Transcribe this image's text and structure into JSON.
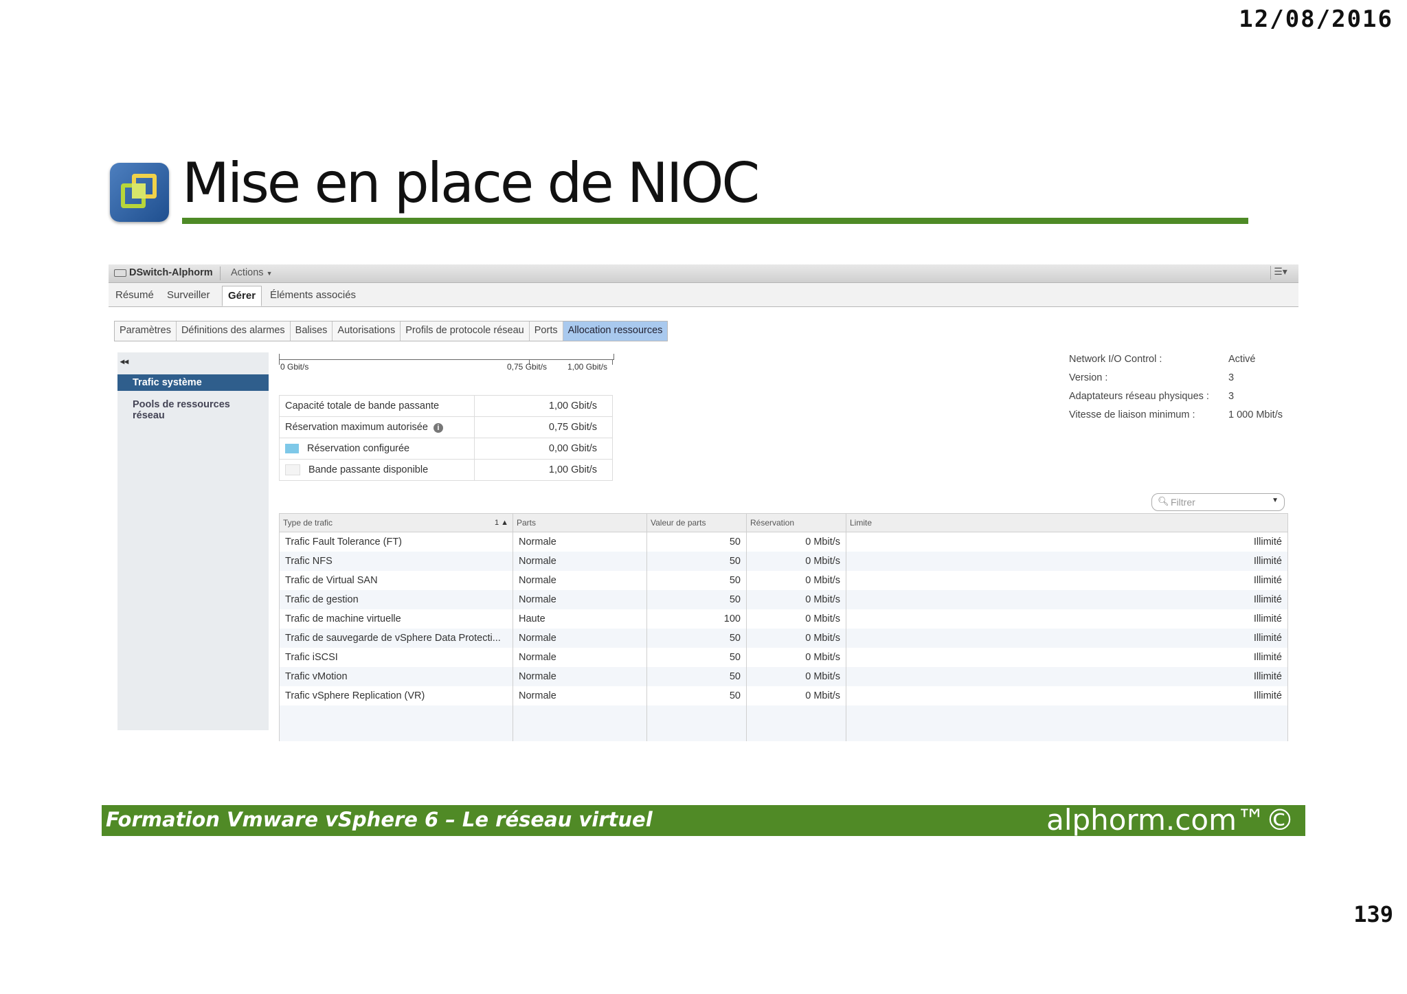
{
  "slide": {
    "date": "12/08/2016",
    "title": "Mise en place de NIOC",
    "page_number": "139",
    "footer_left": "Formation Vmware vSphere 6 – Le réseau virtuel",
    "footer_right": "alphorm.com™©",
    "accent_color": "#4e8a26"
  },
  "app": {
    "switch_name": "DSwitch-Alphorm",
    "actions_label": "Actions",
    "tabs": [
      "Résumé",
      "Surveiller",
      "Gérer",
      "Éléments associés"
    ],
    "active_tab": "Gérer",
    "subtabs": [
      "Paramètres",
      "Définitions des alarmes",
      "Balises",
      "Autorisations",
      "Profils de protocole réseau",
      "Ports",
      "Allocation ressources"
    ],
    "active_subtab": "Allocation ressources"
  },
  "sidebar": {
    "items": [
      "Trafic système",
      "Pools de ressources réseau"
    ],
    "active": "Trafic système"
  },
  "bandwidth_bar": {
    "labels": [
      "0 Gbit/s",
      "0,75 Gbit/s",
      "1,00 Gbit/s"
    ]
  },
  "capacity": [
    {
      "label": "Capacité totale de bande passante",
      "value": "1,00 Gbit/s"
    },
    {
      "label": "Réservation maximum autorisée",
      "value": "0,75 Gbit/s",
      "icon": "info-icon"
    },
    {
      "label": "Réservation configurée",
      "value": "0,00 Gbit/s",
      "swatch": "#7ec8e8"
    },
    {
      "label": "Bande passante disponible",
      "value": "1,00 Gbit/s",
      "swatch": "#f4f4f4"
    }
  ],
  "properties": [
    {
      "key": "Network I/O Control :",
      "value": "Activé"
    },
    {
      "key": "Version :",
      "value": "3"
    },
    {
      "key": "Adaptateurs réseau physiques :",
      "value": "3"
    },
    {
      "key": "Vitesse de liaison minimum :",
      "value": "1 000 Mbit/s"
    }
  ],
  "filter": {
    "placeholder": "Filtrer"
  },
  "grid": {
    "columns": [
      "Type de trafic",
      "Parts",
      "Valeur de parts",
      "Réservation",
      "Limite"
    ],
    "sort_indicator": "1 ▲",
    "rows": [
      [
        "Trafic Fault Tolerance (FT)",
        "Normale",
        "50",
        "0 Mbit/s",
        "Illimité"
      ],
      [
        "Trafic NFS",
        "Normale",
        "50",
        "0 Mbit/s",
        "Illimité"
      ],
      [
        "Trafic de Virtual SAN",
        "Normale",
        "50",
        "0 Mbit/s",
        "Illimité"
      ],
      [
        "Trafic de gestion",
        "Normale",
        "50",
        "0 Mbit/s",
        "Illimité"
      ],
      [
        "Trafic de machine virtuelle",
        "Haute",
        "100",
        "0 Mbit/s",
        "Illimité"
      ],
      [
        "Trafic de sauvegarde de vSphere Data Protecti...",
        "Normale",
        "50",
        "0 Mbit/s",
        "Illimité"
      ],
      [
        "Trafic iSCSI",
        "Normale",
        "50",
        "0 Mbit/s",
        "Illimité"
      ],
      [
        "Trafic vMotion",
        "Normale",
        "50",
        "0 Mbit/s",
        "Illimité"
      ],
      [
        "Trafic vSphere Replication (VR)",
        "Normale",
        "50",
        "0 Mbit/s",
        "Illimité"
      ]
    ]
  }
}
